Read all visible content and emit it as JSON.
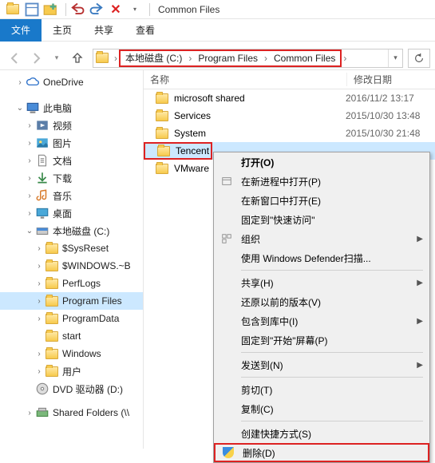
{
  "qat": {
    "title": "Common Files"
  },
  "ribbon": {
    "file": "文件",
    "home": "主页",
    "share": "共享",
    "view": "查看"
  },
  "breadcrumb": {
    "drive": "本地磁盘 (C:)",
    "p1": "Program Files",
    "p2": "Common Files"
  },
  "columns": {
    "name": "名称",
    "date": "修改日期"
  },
  "tree": {
    "onedrive": "OneDrive",
    "thispc": "此电脑",
    "videos": "视频",
    "pictures": "图片",
    "documents": "文档",
    "downloads": "下载",
    "music": "音乐",
    "desktop": "桌面",
    "localdisk": "本地磁盘 (C:)",
    "sysreset": "$SysReset",
    "windowsbt": "$WINDOWS.~B",
    "perflogs": "PerfLogs",
    "programfiles": "Program Files",
    "programdata": "ProgramData",
    "start": "start",
    "windows": "Windows",
    "users": "用户",
    "dvd": "DVD 驱动器 (D:)",
    "shared": "Shared Folders (\\\\"
  },
  "rows": [
    {
      "name": "microsoft shared",
      "date": "2016/11/2 13:17"
    },
    {
      "name": "Services",
      "date": "2015/10/30 13:48"
    },
    {
      "name": "System",
      "date": "2015/10/30 21:48"
    },
    {
      "name": "Tencent",
      "date": ""
    },
    {
      "name": "VMware",
      "date": ""
    }
  ],
  "ctx": {
    "open": "打开(O)",
    "open_new_proc": "在新进程中打开(P)",
    "open_new_win": "在新窗口中打开(E)",
    "pin_quick": "固定到\"快速访问\"",
    "organize": "组织",
    "defender": "使用 Windows Defender扫描...",
    "share": "共享(H)",
    "restore": "还原以前的版本(V)",
    "include_lib": "包含到库中(I)",
    "pin_start": "固定到\"开始\"屏幕(P)",
    "send_to": "发送到(N)",
    "cut": "剪切(T)",
    "copy": "复制(C)",
    "shortcut": "创建快捷方式(S)",
    "delete": "删除(D)"
  }
}
